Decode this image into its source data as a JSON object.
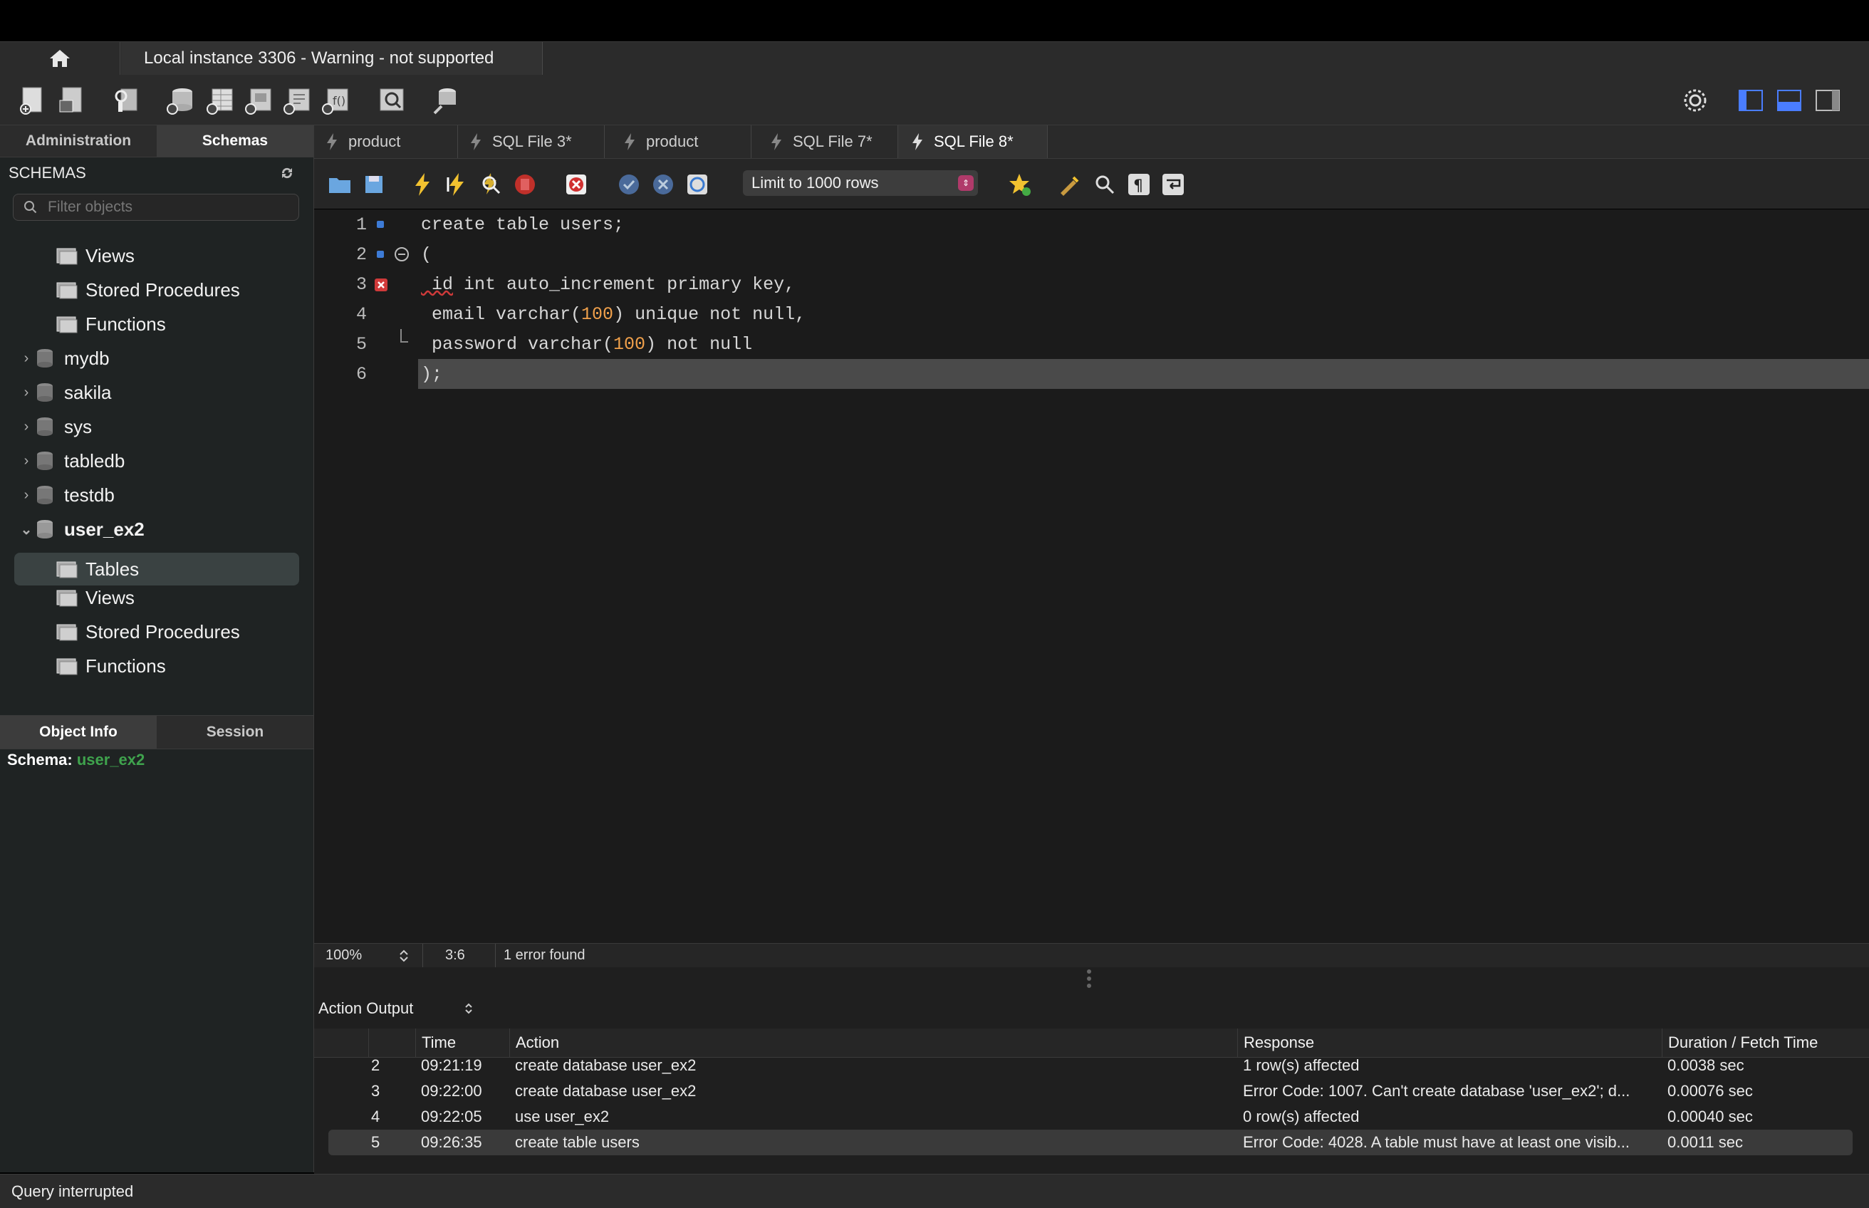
{
  "connection_tab": {
    "title": "Local instance 3306 - Warning - not supported"
  },
  "left_panel": {
    "tabs": [
      {
        "label": "Administration"
      },
      {
        "label": "Schemas"
      }
    ],
    "schemas_title": "SCHEMAS",
    "filter_placeholder": "Filter objects",
    "tree": [
      {
        "label": "Views"
      },
      {
        "label": "Stored Procedures"
      },
      {
        "label": "Functions"
      },
      {
        "label": "mydb"
      },
      {
        "label": "sakila"
      },
      {
        "label": "sys"
      },
      {
        "label": "tabledb"
      },
      {
        "label": "testdb"
      },
      {
        "label": "user_ex2"
      },
      {
        "label": "Tables"
      },
      {
        "label": "Views"
      },
      {
        "label": "Stored Procedures"
      },
      {
        "label": "Functions"
      }
    ],
    "info_tabs": [
      {
        "label": "Object Info"
      },
      {
        "label": "Session"
      }
    ],
    "schema_info": {
      "label": "Schema:",
      "value": "user_ex2"
    }
  },
  "editor_tabs": [
    {
      "label": "product"
    },
    {
      "label": "SQL File 3*"
    },
    {
      "label": "product"
    },
    {
      "label": "SQL File 7*"
    },
    {
      "label": "SQL File 8*"
    }
  ],
  "editor_toolbar": {
    "limit": "Limit to 1000 rows"
  },
  "code": {
    "lines": [
      {
        "n": "1",
        "t": "create table users;"
      },
      {
        "n": "2",
        "t": "("
      },
      {
        "n": "3",
        "a": " id",
        "b": " int auto_increment primary key,"
      },
      {
        "n": "4",
        "a": " email varchar(",
        "num": "100",
        "b": ") unique not null,"
      },
      {
        "n": "5",
        "a": " password varchar(",
        "num": "100",
        "b": ") not null"
      },
      {
        "n": "6",
        "t": ");"
      }
    ]
  },
  "editor_status": {
    "zoom": "100%",
    "cursor": "3:6",
    "message": "1 error found"
  },
  "output": {
    "selector": "Action Output",
    "columns": [
      "Time",
      "Action",
      "Response",
      "Duration / Fetch Time"
    ],
    "rows": [
      {
        "status": "ok",
        "num": "2",
        "time": "09:21:19",
        "action": "create database user_ex2",
        "response": "1 row(s) affected",
        "duration": "0.0038 sec"
      },
      {
        "status": "err",
        "num": "3",
        "time": "09:22:00",
        "action": "create database user_ex2",
        "response": "Error Code: 1007. Can't create database 'user_ex2'; d...",
        "duration": "0.00076 sec"
      },
      {
        "status": "ok",
        "num": "4",
        "time": "09:22:05",
        "action": "use user_ex2",
        "response": "0 row(s) affected",
        "duration": "0.00040 sec"
      },
      {
        "status": "err",
        "num": "5",
        "time": "09:26:35",
        "action": "create table users",
        "response": "Error Code: 4028. A table must have at least one visib...",
        "duration": "0.0011 sec"
      }
    ]
  },
  "status_bar": {
    "message": "Query interrupted"
  }
}
